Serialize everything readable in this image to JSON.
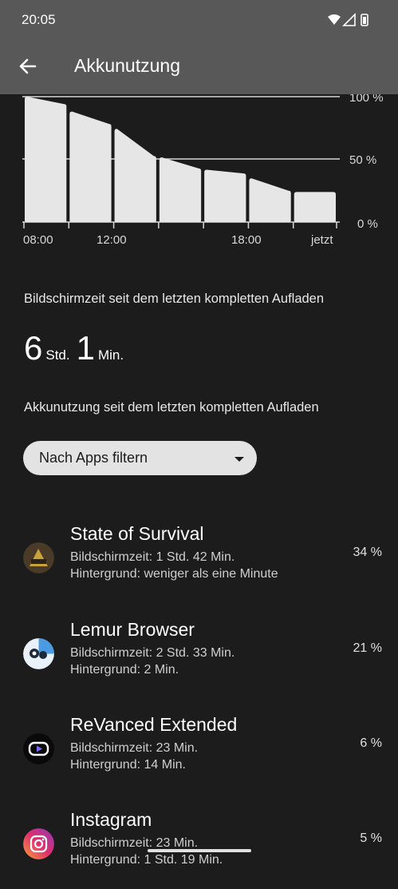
{
  "status": {
    "time": "20:05"
  },
  "appbar": {
    "title": "Akkunutzung"
  },
  "chart_data": {
    "type": "bar",
    "x_tick_labels": [
      "08:00",
      "12:00",
      "18:00",
      "jetzt"
    ],
    "y_tick_labels": [
      "100 %",
      "50 %",
      "0 %"
    ],
    "ylim": [
      0,
      100
    ],
    "segments": [
      {
        "start": 100,
        "end": 94
      },
      {
        "start": 88,
        "end": 78
      },
      {
        "start": 74,
        "end": 52
      },
      {
        "start": 51,
        "end": 42
      },
      {
        "start": 41,
        "end": 38
      },
      {
        "start": 34,
        "end": 24
      },
      {
        "start": 23,
        "end": 23
      }
    ]
  },
  "screen_time": {
    "label": "Bildschirmzeit seit dem letzten kompletten Aufladen",
    "hours": "6",
    "hours_unit": "Std.",
    "minutes": "1",
    "minutes_unit": "Min."
  },
  "usage": {
    "label": "Akkunutzung seit dem letzten kompletten Aufladen",
    "filter_label": "Nach Apps filtern"
  },
  "apps": [
    {
      "name": "State of Survival",
      "line1": "Bildschirmzeit: 1 Std. 42 Min.",
      "line2": "Hintergrund: weniger als eine Minute",
      "percent": "34 %",
      "icon": "state-of-survival-icon"
    },
    {
      "name": "Lemur Browser",
      "line1": "Bildschirmzeit: 2 Std. 33 Min.",
      "line2": "Hintergrund: 2 Min.",
      "percent": "21 %",
      "icon": "lemur-browser-icon"
    },
    {
      "name": "ReVanced Extended",
      "line1": "Bildschirmzeit: 23 Min.",
      "line2": "Hintergrund: 14 Min.",
      "percent": "6 %",
      "icon": "revanced-icon"
    },
    {
      "name": "Instagram",
      "line1": "Bildschirmzeit: 23 Min.",
      "line2": "Hintergrund: 1 Std. 19 Min.",
      "percent": "5 %",
      "icon": "instagram-icon"
    }
  ],
  "colors": {
    "bar": "#e6e6e6",
    "background": "#1c1c1c",
    "appbar": "#585858"
  }
}
